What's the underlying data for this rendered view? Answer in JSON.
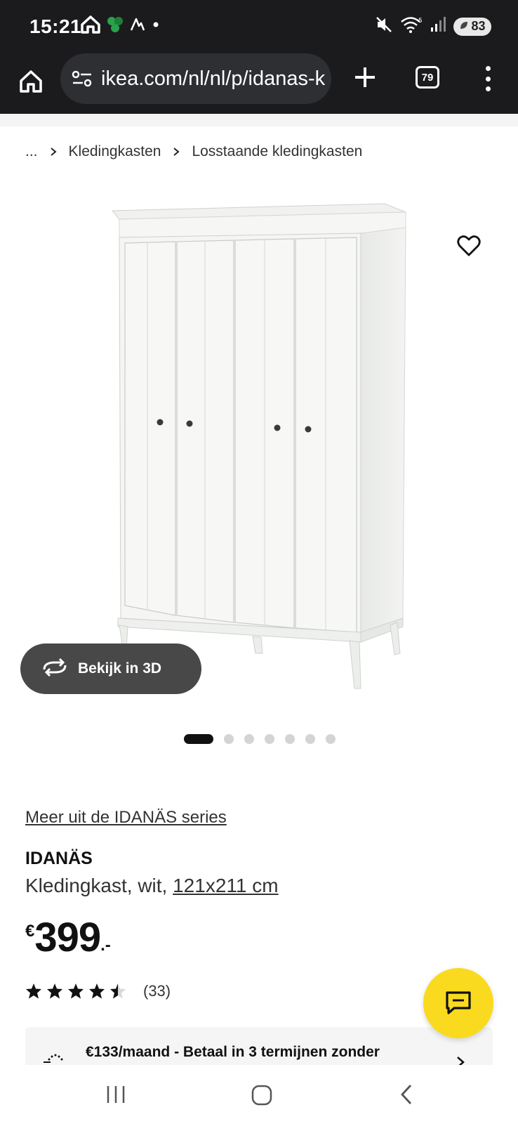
{
  "status_bar": {
    "time": "15:21",
    "battery": "83"
  },
  "browser": {
    "url": "ikea.com/nl/nl/p/idanas-k",
    "tab_count": "79"
  },
  "breadcrumb": {
    "ellipsis": "...",
    "items": [
      "Kledingkasten",
      "Losstaande kledingkasten"
    ]
  },
  "gallery": {
    "view_3d_label": "Bekijk in 3D",
    "image_count": 7,
    "active_index": 0
  },
  "product": {
    "series_link": "Meer uit de IDANÄS series",
    "name": "IDANÄS",
    "description": "Kledingkast, wit, ",
    "size": "121x211 cm",
    "currency": "€",
    "price": "399",
    "price_suffix": ".-",
    "rating_value": 4.5,
    "rating_count": "(33)"
  },
  "payment_banner": {
    "text": "€133/maand - Betaal in 3 termijnen zonder"
  },
  "colors": {
    "chat_button": "#fada1e",
    "view_3d_button": "#484848",
    "browser_chrome": "#1b1b1d"
  }
}
